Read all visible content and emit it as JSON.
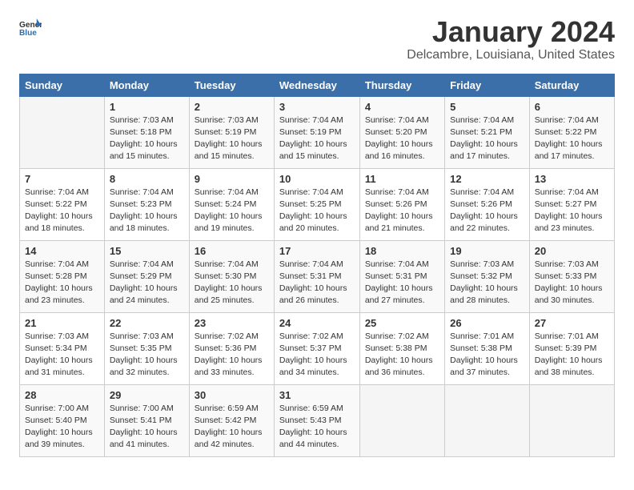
{
  "logo": {
    "text_general": "General",
    "text_blue": "Blue"
  },
  "title": "January 2024",
  "location": "Delcambre, Louisiana, United States",
  "days_of_week": [
    "Sunday",
    "Monday",
    "Tuesday",
    "Wednesday",
    "Thursday",
    "Friday",
    "Saturday"
  ],
  "weeks": [
    [
      {
        "day": "",
        "info": ""
      },
      {
        "day": "1",
        "info": "Sunrise: 7:03 AM\nSunset: 5:18 PM\nDaylight: 10 hours\nand 15 minutes."
      },
      {
        "day": "2",
        "info": "Sunrise: 7:03 AM\nSunset: 5:19 PM\nDaylight: 10 hours\nand 15 minutes."
      },
      {
        "day": "3",
        "info": "Sunrise: 7:04 AM\nSunset: 5:19 PM\nDaylight: 10 hours\nand 15 minutes."
      },
      {
        "day": "4",
        "info": "Sunrise: 7:04 AM\nSunset: 5:20 PM\nDaylight: 10 hours\nand 16 minutes."
      },
      {
        "day": "5",
        "info": "Sunrise: 7:04 AM\nSunset: 5:21 PM\nDaylight: 10 hours\nand 17 minutes."
      },
      {
        "day": "6",
        "info": "Sunrise: 7:04 AM\nSunset: 5:22 PM\nDaylight: 10 hours\nand 17 minutes."
      }
    ],
    [
      {
        "day": "7",
        "info": "Sunrise: 7:04 AM\nSunset: 5:22 PM\nDaylight: 10 hours\nand 18 minutes."
      },
      {
        "day": "8",
        "info": "Sunrise: 7:04 AM\nSunset: 5:23 PM\nDaylight: 10 hours\nand 18 minutes."
      },
      {
        "day": "9",
        "info": "Sunrise: 7:04 AM\nSunset: 5:24 PM\nDaylight: 10 hours\nand 19 minutes."
      },
      {
        "day": "10",
        "info": "Sunrise: 7:04 AM\nSunset: 5:25 PM\nDaylight: 10 hours\nand 20 minutes."
      },
      {
        "day": "11",
        "info": "Sunrise: 7:04 AM\nSunset: 5:26 PM\nDaylight: 10 hours\nand 21 minutes."
      },
      {
        "day": "12",
        "info": "Sunrise: 7:04 AM\nSunset: 5:26 PM\nDaylight: 10 hours\nand 22 minutes."
      },
      {
        "day": "13",
        "info": "Sunrise: 7:04 AM\nSunset: 5:27 PM\nDaylight: 10 hours\nand 23 minutes."
      }
    ],
    [
      {
        "day": "14",
        "info": "Sunrise: 7:04 AM\nSunset: 5:28 PM\nDaylight: 10 hours\nand 23 minutes."
      },
      {
        "day": "15",
        "info": "Sunrise: 7:04 AM\nSunset: 5:29 PM\nDaylight: 10 hours\nand 24 minutes."
      },
      {
        "day": "16",
        "info": "Sunrise: 7:04 AM\nSunset: 5:30 PM\nDaylight: 10 hours\nand 25 minutes."
      },
      {
        "day": "17",
        "info": "Sunrise: 7:04 AM\nSunset: 5:31 PM\nDaylight: 10 hours\nand 26 minutes."
      },
      {
        "day": "18",
        "info": "Sunrise: 7:04 AM\nSunset: 5:31 PM\nDaylight: 10 hours\nand 27 minutes."
      },
      {
        "day": "19",
        "info": "Sunrise: 7:03 AM\nSunset: 5:32 PM\nDaylight: 10 hours\nand 28 minutes."
      },
      {
        "day": "20",
        "info": "Sunrise: 7:03 AM\nSunset: 5:33 PM\nDaylight: 10 hours\nand 30 minutes."
      }
    ],
    [
      {
        "day": "21",
        "info": "Sunrise: 7:03 AM\nSunset: 5:34 PM\nDaylight: 10 hours\nand 31 minutes."
      },
      {
        "day": "22",
        "info": "Sunrise: 7:03 AM\nSunset: 5:35 PM\nDaylight: 10 hours\nand 32 minutes."
      },
      {
        "day": "23",
        "info": "Sunrise: 7:02 AM\nSunset: 5:36 PM\nDaylight: 10 hours\nand 33 minutes."
      },
      {
        "day": "24",
        "info": "Sunrise: 7:02 AM\nSunset: 5:37 PM\nDaylight: 10 hours\nand 34 minutes."
      },
      {
        "day": "25",
        "info": "Sunrise: 7:02 AM\nSunset: 5:38 PM\nDaylight: 10 hours\nand 36 minutes."
      },
      {
        "day": "26",
        "info": "Sunrise: 7:01 AM\nSunset: 5:38 PM\nDaylight: 10 hours\nand 37 minutes."
      },
      {
        "day": "27",
        "info": "Sunrise: 7:01 AM\nSunset: 5:39 PM\nDaylight: 10 hours\nand 38 minutes."
      }
    ],
    [
      {
        "day": "28",
        "info": "Sunrise: 7:00 AM\nSunset: 5:40 PM\nDaylight: 10 hours\nand 39 minutes."
      },
      {
        "day": "29",
        "info": "Sunrise: 7:00 AM\nSunset: 5:41 PM\nDaylight: 10 hours\nand 41 minutes."
      },
      {
        "day": "30",
        "info": "Sunrise: 6:59 AM\nSunset: 5:42 PM\nDaylight: 10 hours\nand 42 minutes."
      },
      {
        "day": "31",
        "info": "Sunrise: 6:59 AM\nSunset: 5:43 PM\nDaylight: 10 hours\nand 44 minutes."
      },
      {
        "day": "",
        "info": ""
      },
      {
        "day": "",
        "info": ""
      },
      {
        "day": "",
        "info": ""
      }
    ]
  ]
}
